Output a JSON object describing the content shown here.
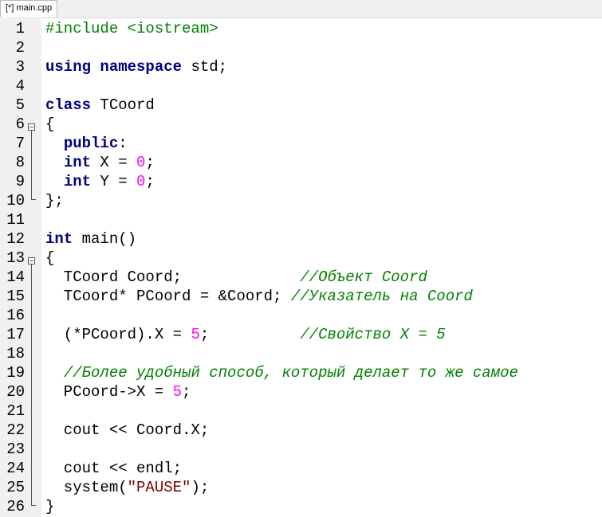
{
  "tab": {
    "title": "[*] main.cpp"
  },
  "lines": [
    {
      "n": "1",
      "tokens": [
        {
          "t": "#include &lt;iostream&gt;",
          "c": "pp"
        }
      ]
    },
    {
      "n": "2",
      "tokens": []
    },
    {
      "n": "3",
      "tokens": [
        {
          "t": "using",
          "c": "kw"
        },
        {
          "t": " ",
          "c": ""
        },
        {
          "t": "namespace",
          "c": "kw"
        },
        {
          "t": " std;",
          "c": ""
        }
      ]
    },
    {
      "n": "4",
      "tokens": []
    },
    {
      "n": "5",
      "tokens": [
        {
          "t": "class",
          "c": "kw"
        },
        {
          "t": " TCoord",
          "c": ""
        }
      ]
    },
    {
      "n": "6",
      "tokens": [
        {
          "t": "{",
          "c": ""
        }
      ]
    },
    {
      "n": "7",
      "tokens": [
        {
          "t": "  ",
          "c": ""
        },
        {
          "t": "public",
          "c": "kw"
        },
        {
          "t": ":",
          "c": ""
        }
      ]
    },
    {
      "n": "8",
      "tokens": [
        {
          "t": "  ",
          "c": ""
        },
        {
          "t": "int",
          "c": "kw"
        },
        {
          "t": " X = ",
          "c": ""
        },
        {
          "t": "0",
          "c": "num"
        },
        {
          "t": ";",
          "c": ""
        }
      ]
    },
    {
      "n": "9",
      "tokens": [
        {
          "t": "  ",
          "c": ""
        },
        {
          "t": "int",
          "c": "kw"
        },
        {
          "t": " Y = ",
          "c": ""
        },
        {
          "t": "0",
          "c": "num"
        },
        {
          "t": ";",
          "c": ""
        }
      ]
    },
    {
      "n": "10",
      "tokens": [
        {
          "t": "};",
          "c": ""
        }
      ]
    },
    {
      "n": "11",
      "tokens": []
    },
    {
      "n": "12",
      "tokens": [
        {
          "t": "int",
          "c": "kw"
        },
        {
          "t": " main()",
          "c": ""
        }
      ]
    },
    {
      "n": "13",
      "tokens": [
        {
          "t": "{",
          "c": ""
        }
      ]
    },
    {
      "n": "14",
      "tokens": [
        {
          "t": "  TCoord Coord;             ",
          "c": ""
        },
        {
          "t": "//Объект Coord",
          "c": "cm"
        }
      ]
    },
    {
      "n": "15",
      "tokens": [
        {
          "t": "  TCoord* PCoord = &Coord; ",
          "c": ""
        },
        {
          "t": "//Указатель на Coord",
          "c": "cm"
        }
      ]
    },
    {
      "n": "16",
      "tokens": []
    },
    {
      "n": "17",
      "tokens": [
        {
          "t": "  (*PCoord).X = ",
          "c": ""
        },
        {
          "t": "5",
          "c": "num"
        },
        {
          "t": ";          ",
          "c": ""
        },
        {
          "t": "//Свойство X = 5",
          "c": "cm"
        }
      ]
    },
    {
      "n": "18",
      "tokens": []
    },
    {
      "n": "19",
      "tokens": [
        {
          "t": "  ",
          "c": ""
        },
        {
          "t": "//Более удобный способ, который делает то же самое",
          "c": "cm"
        }
      ]
    },
    {
      "n": "20",
      "tokens": [
        {
          "t": "  PCoord->X = ",
          "c": ""
        },
        {
          "t": "5",
          "c": "num"
        },
        {
          "t": ";",
          "c": ""
        }
      ]
    },
    {
      "n": "21",
      "tokens": []
    },
    {
      "n": "22",
      "tokens": [
        {
          "t": "  cout << Coord.X;",
          "c": ""
        }
      ]
    },
    {
      "n": "23",
      "tokens": []
    },
    {
      "n": "24",
      "tokens": [
        {
          "t": "  cout << endl;",
          "c": ""
        }
      ]
    },
    {
      "n": "25",
      "tokens": [
        {
          "t": "  system(",
          "c": ""
        },
        {
          "t": "\"PAUSE\"",
          "c": "str"
        },
        {
          "t": ");",
          "c": ""
        }
      ]
    },
    {
      "n": "26",
      "tokens": [
        {
          "t": "}",
          "c": ""
        }
      ]
    }
  ]
}
